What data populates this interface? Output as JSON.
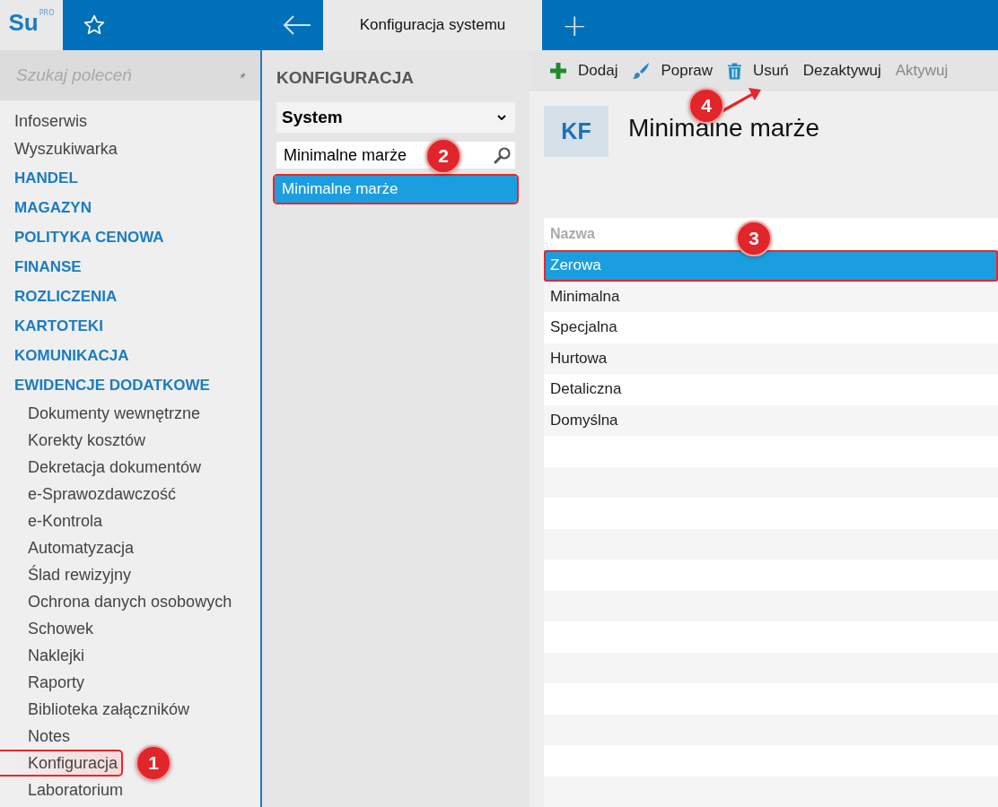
{
  "header": {
    "logo": "Su",
    "logo_badge": "PRO",
    "tabs": [
      {
        "label": "Konfiguracja systemu",
        "selected": true
      }
    ],
    "new_tab": "+"
  },
  "sidebar": {
    "search_placeholder": "Szukaj poleceń",
    "items": [
      {
        "label": "Infoserwis",
        "kind": "link",
        "highlighted": false
      },
      {
        "label": "Wyszukiwarka",
        "kind": "link",
        "highlighted": false
      },
      {
        "label": "HANDEL",
        "kind": "section",
        "highlighted": false
      },
      {
        "label": "MAGAZYN",
        "kind": "section",
        "highlighted": false
      },
      {
        "label": "POLITYKA CENOWA",
        "kind": "section",
        "highlighted": false
      },
      {
        "label": "FINANSE",
        "kind": "section",
        "highlighted": false
      },
      {
        "label": "ROZLICZENIA",
        "kind": "section",
        "highlighted": false
      },
      {
        "label": "KARTOTEKI",
        "kind": "section",
        "highlighted": false
      },
      {
        "label": "KOMUNIKACJA",
        "kind": "section",
        "highlighted": false
      },
      {
        "label": "EWIDENCJE DODATKOWE",
        "kind": "section",
        "highlighted": false
      },
      {
        "label": "Dokumenty wewnętrzne",
        "kind": "subitem",
        "highlighted": false
      },
      {
        "label": "Korekty kosztów",
        "kind": "subitem",
        "highlighted": false
      },
      {
        "label": "Dekretacja dokumentów",
        "kind": "subitem",
        "highlighted": false
      },
      {
        "label": "e-Sprawozdawczość",
        "kind": "subitem",
        "highlighted": false
      },
      {
        "label": "e-Kontrola",
        "kind": "subitem",
        "highlighted": false
      },
      {
        "label": "Automatyzacja",
        "kind": "subitem",
        "highlighted": false
      },
      {
        "label": "Ślad rewizyjny",
        "kind": "subitem",
        "highlighted": false
      },
      {
        "label": "Ochrona danych osobowych",
        "kind": "subitem",
        "highlighted": false
      },
      {
        "label": "Schowek",
        "kind": "subitem",
        "highlighted": false
      },
      {
        "label": "Naklejki",
        "kind": "subitem",
        "highlighted": false
      },
      {
        "label": "Raporty",
        "kind": "subitem",
        "highlighted": false
      },
      {
        "label": "Biblioteka załączników",
        "kind": "subitem",
        "highlighted": false
      },
      {
        "label": "Notes",
        "kind": "subitem",
        "highlighted": false
      },
      {
        "label": "Konfiguracja",
        "kind": "subitem",
        "highlighted": true
      },
      {
        "label": "Laboratorium",
        "kind": "subitem",
        "highlighted": false
      }
    ]
  },
  "config_panel": {
    "title": "KONFIGURACJA",
    "dropdown": "System",
    "search_value": "Minimalne marże",
    "results": [
      {
        "label": "Minimalne marże",
        "selected": true,
        "highlighted": true
      }
    ]
  },
  "toolbar": [
    {
      "label": "Dodaj",
      "kind": "add",
      "disabled": false
    },
    {
      "label": "Popraw",
      "kind": "edit",
      "disabled": false
    },
    {
      "label": "Usuń",
      "kind": "delete",
      "disabled": false
    },
    {
      "label": "Dezaktywuj",
      "kind": "text",
      "disabled": false
    },
    {
      "label": "Aktywuj",
      "kind": "text",
      "disabled": true
    }
  ],
  "detail": {
    "badge": "KF",
    "title": "Minimalne marże",
    "table": {
      "columns": [
        "Nazwa"
      ],
      "rows": [
        {
          "name": "Zerowa",
          "selected": true,
          "highlighted": true
        },
        {
          "name": "Minimalna",
          "selected": false,
          "highlighted": false
        },
        {
          "name": "Specjalna",
          "selected": false,
          "highlighted": false
        },
        {
          "name": "Hurtowa",
          "selected": false,
          "highlighted": false
        },
        {
          "name": "Detaliczna",
          "selected": false,
          "highlighted": false
        },
        {
          "name": "Domyślna",
          "selected": false,
          "highlighted": false
        }
      ]
    }
  },
  "callouts": [
    "1",
    "2",
    "3",
    "4"
  ]
}
